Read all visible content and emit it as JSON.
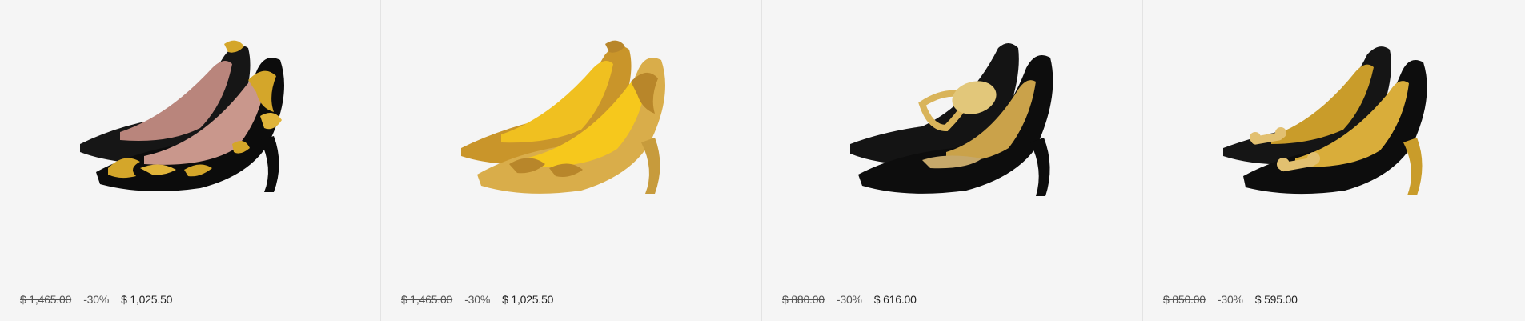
{
  "products": [
    {
      "image": "black-gold-baroque-pump",
      "old_price": "$ 1,465.00",
      "discount": "-30%",
      "price": "$ 1,025.50"
    },
    {
      "image": "gold-baroque-pump",
      "old_price": "$ 1,465.00",
      "discount": "-30%",
      "price": "$ 1,025.50"
    },
    {
      "image": "black-spoon-strap-pump",
      "old_price": "$ 880.00",
      "discount": "-30%",
      "price": "$ 616.00"
    },
    {
      "image": "black-bow-pump",
      "old_price": "$ 850.00",
      "discount": "-30%",
      "price": "$ 595.00"
    }
  ],
  "colors": {
    "card_bg": "#f5f5f5",
    "divider": "#e3e3e3",
    "gold": "#d4a62a",
    "black": "#111111"
  }
}
